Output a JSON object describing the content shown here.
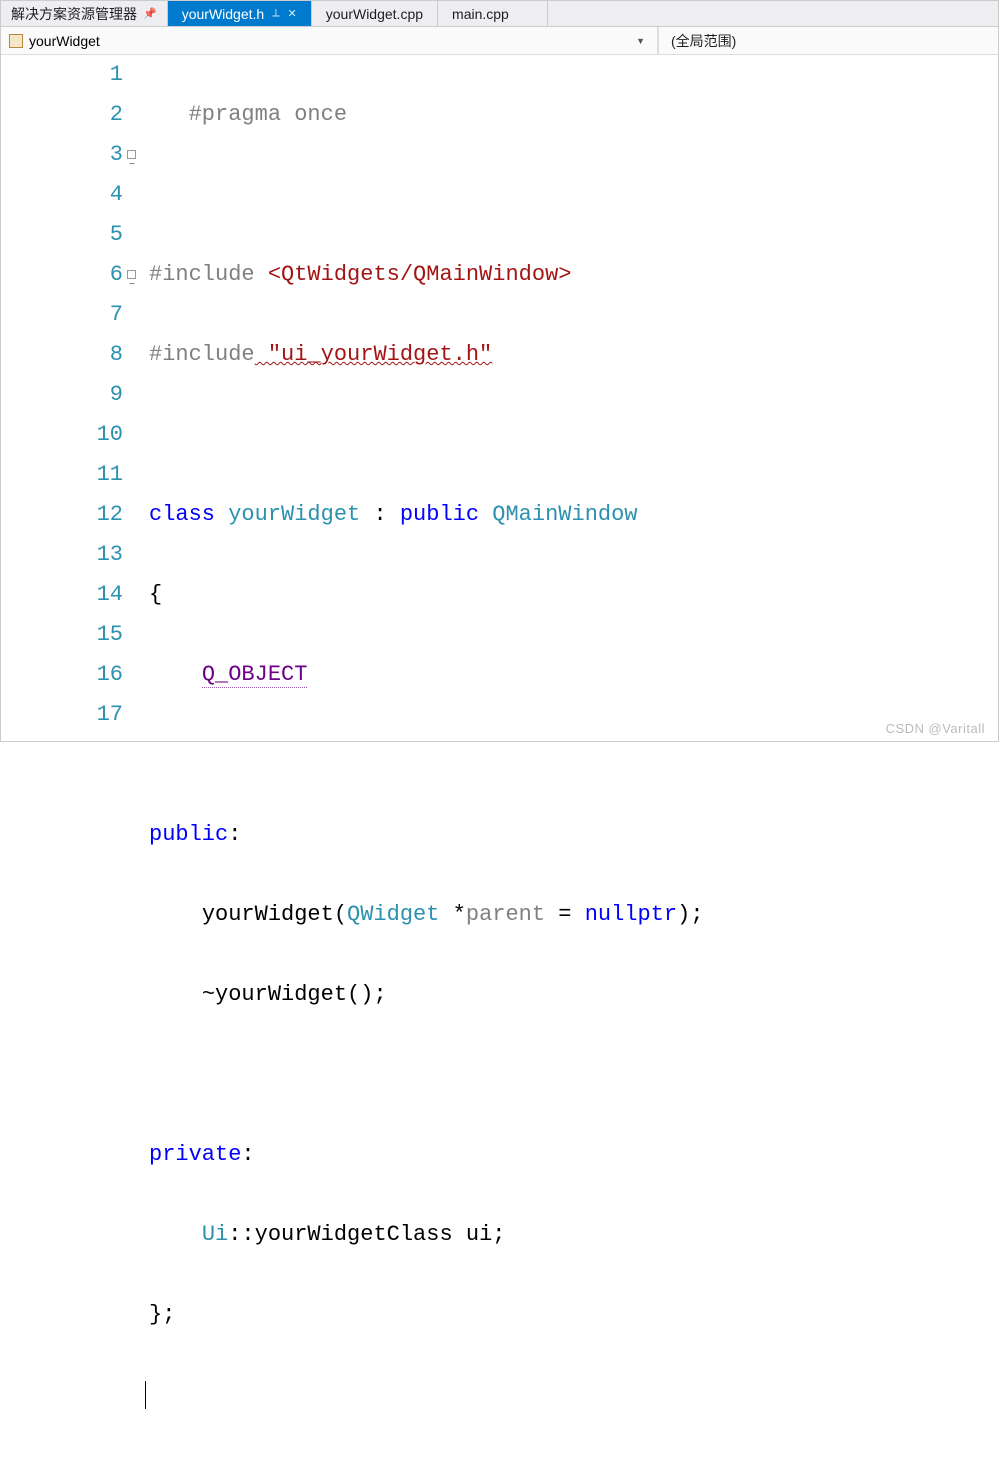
{
  "tabs": {
    "solution_explorer": "解决方案资源管理器",
    "files": [
      {
        "label": "yourWidget.h",
        "active": true
      },
      {
        "label": "yourWidget.cpp",
        "active": false
      },
      {
        "label": "main.cpp",
        "active": false
      }
    ]
  },
  "navbar": {
    "scope_left": "yourWidget",
    "scope_right": "(全局范围)"
  },
  "code": {
    "line_numbers": [
      "1",
      "2",
      "3",
      "4",
      "5",
      "6",
      "7",
      "8",
      "9",
      "10",
      "11",
      "12",
      "13",
      "14",
      "15",
      "16",
      "17"
    ],
    "l1_pragma": "#pragma",
    "l1_once": " once",
    "l3_inc_kw": "#include",
    "l3_inc_val": " <QtWidgets/QMainWindow>",
    "l4_inc_kw": "#include",
    "l4_inc_val": " \"ui_yourWidget.h\"",
    "l6_class": "class",
    "l6_name": " yourWidget ",
    "l6_colon": ": ",
    "l6_public": "public",
    "l6_base": " QMainWindow",
    "l7_brace": "{",
    "l8_qobj": "Q_OBJECT",
    "l10_public": "public",
    "l10_colon": ":",
    "l11_ctor_name": "yourWidget(",
    "l11_qwidget": "QWidget",
    "l11_star": " *",
    "l11_param": "parent",
    "l11_eq": " = ",
    "l11_nullptr": "nullptr",
    "l11_end": ");",
    "l12_dtor": "~yourWidget();",
    "l14_private": "private",
    "l14_colon": ":",
    "l15_ui_ns": "Ui",
    "l15_sep": "::",
    "l15_cls": "yourWidgetClass",
    "l15_var": " ui;",
    "l16_brace": "};"
  },
  "watermark": "CSDN @Varitall"
}
